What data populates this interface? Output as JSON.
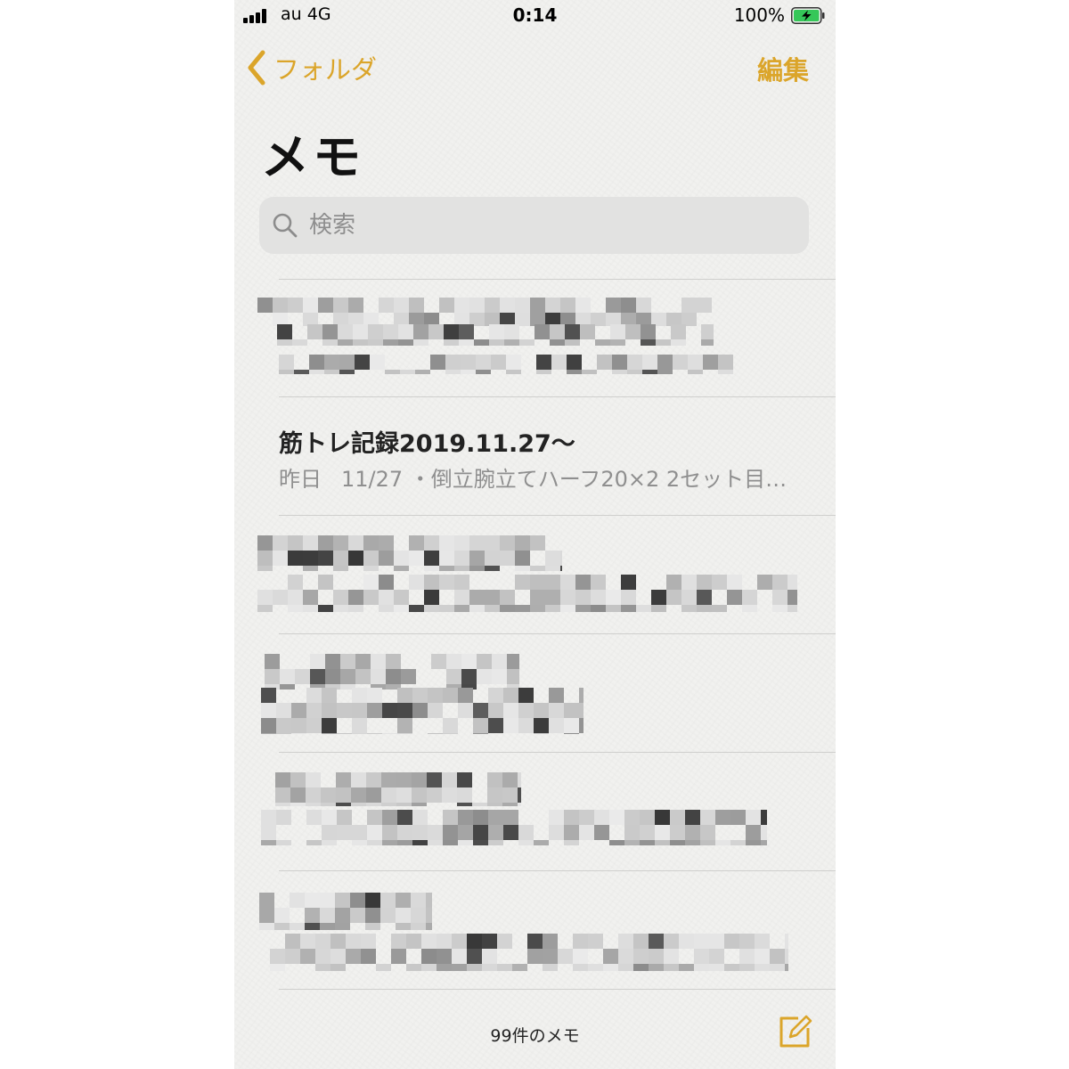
{
  "status_bar": {
    "carrier": "au 4G",
    "time": "0:14",
    "battery": "100%"
  },
  "nav": {
    "back_label": "フォルダ",
    "edit_label": "編集"
  },
  "page": {
    "title": "メモ"
  },
  "search": {
    "placeholder": "検索"
  },
  "notes": [
    {
      "redacted": true
    },
    {
      "title": "筋トレ記録2019.11.27〜",
      "date": "昨日",
      "preview": "11/27 ・倒立腕立てハーフ20×2 2セット目…"
    },
    {
      "redacted": true
    },
    {
      "redacted": true
    },
    {
      "redacted": true
    },
    {
      "redacted": true
    }
  ],
  "footer": {
    "count_label": "99件のメモ"
  },
  "colors": {
    "accent": "#dba52a",
    "background": "#f1f1ef",
    "search_field": "#e2e2e1"
  },
  "icons": {
    "back": "chevron-left-icon",
    "search": "search-icon",
    "compose": "compose-icon",
    "battery": "battery-charging-icon",
    "signal": "signal-icon"
  }
}
